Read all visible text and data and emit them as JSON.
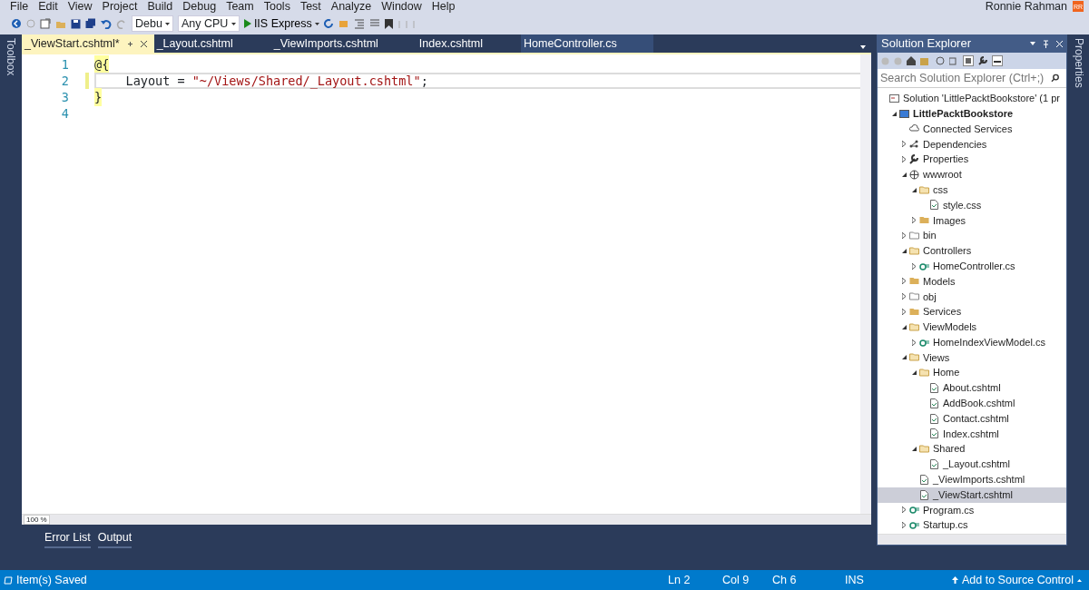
{
  "menu": [
    "File",
    "Edit",
    "View",
    "Project",
    "Build",
    "Debug",
    "Team",
    "Tools",
    "Test",
    "Analyze",
    "Window",
    "Help"
  ],
  "user": {
    "name": "Ronnie Rahman",
    "initials": "RR"
  },
  "toolbar": {
    "configuration": "Debu",
    "platform": "Any CPU",
    "run": "IIS Express"
  },
  "left_strip": "Toolbox",
  "right_strip": "Properties",
  "tabs": [
    {
      "label": "_ViewStart.cshtml*",
      "selected": true
    },
    {
      "label": "_Layout.cshtml",
      "selected": false
    },
    {
      "label": "_ViewImports.cshtml",
      "selected": false
    },
    {
      "label": "Index.cshtml",
      "selected": false
    },
    {
      "label": "HomeController.cs",
      "selected": false
    }
  ],
  "editor": {
    "zoom": "100 %",
    "lines": [
      {
        "number": "1",
        "current": false,
        "segments": [
          {
            "text": "@{",
            "kind": "razor"
          }
        ]
      },
      {
        "number": "2",
        "current": true,
        "segments": [
          {
            "text": "    Layout = ",
            "kind": "plain"
          },
          {
            "text": "\"~/Views/Shared/_Layout.cshtml\"",
            "kind": "string"
          },
          {
            "text": ";",
            "kind": "plain"
          }
        ]
      },
      {
        "number": "3",
        "current": false,
        "segments": [
          {
            "text": "}",
            "kind": "razor"
          }
        ]
      },
      {
        "number": "4",
        "current": false
      }
    ]
  },
  "solution_explorer": {
    "title": "Solution Explorer",
    "search": {
      "placeholder": "Search Solution Explorer (Ctrl+;)"
    },
    "tree": [
      {
        "label": "Solution 'LittlePacktBookstore' (1 pr",
        "kind": "solution",
        "selected": false,
        "children": [
          {
            "label": "LittlePacktBookstore",
            "kind": "project",
            "bold": true,
            "expanded": true,
            "selected": false,
            "children": [
              {
                "label": "Connected Services",
                "kind": "cloud",
                "selected": false
              },
              {
                "label": "Dependencies",
                "kind": "deps",
                "expanded": false,
                "selected": false
              },
              {
                "label": "Properties",
                "kind": "wrench",
                "expanded": false,
                "selected": false
              },
              {
                "label": "wwwroot",
                "kind": "globe",
                "expanded": true,
                "selected": false,
                "children": [
                  {
                    "label": "css",
                    "kind": "folder-open",
                    "expanded": true,
                    "selected": false,
                    "children": [
                      {
                        "label": "style.css",
                        "kind": "file",
                        "selected": false
                      }
                    ]
                  },
                  {
                    "label": "Images",
                    "kind": "folder",
                    "expanded": false,
                    "selected": false
                  }
                ]
              },
              {
                "label": "bin",
                "kind": "folder-empty",
                "expanded": false,
                "selected": false
              },
              {
                "label": "Controllers",
                "kind": "folder-open",
                "expanded": true,
                "selected": false,
                "children": [
                  {
                    "label": "HomeController.cs",
                    "kind": "csharp",
                    "expanded": false,
                    "selected": false
                  }
                ]
              },
              {
                "label": "Models",
                "kind": "folder",
                "expanded": false,
                "selected": false
              },
              {
                "label": "obj",
                "kind": "folder-empty",
                "expanded": false,
                "selected": false
              },
              {
                "label": "Services",
                "kind": "folder",
                "expanded": false,
                "selected": false
              },
              {
                "label": "ViewModels",
                "kind": "folder-open",
                "expanded": true,
                "selected": false,
                "children": [
                  {
                    "label": "HomeIndexViewModel.cs",
                    "kind": "csharp",
                    "expanded": false,
                    "selected": false
                  }
                ]
              },
              {
                "label": "Views",
                "kind": "folder-open",
                "expanded": true,
                "selected": false,
                "children": [
                  {
                    "label": "Home",
                    "kind": "folder-open",
                    "expanded": true,
                    "selected": false,
                    "children": [
                      {
                        "label": "About.cshtml",
                        "kind": "file",
                        "selected": false
                      },
                      {
                        "label": "AddBook.cshtml",
                        "kind": "file",
                        "selected": false
                      },
                      {
                        "label": "Contact.cshtml",
                        "kind": "file",
                        "selected": false
                      },
                      {
                        "label": "Index.cshtml",
                        "kind": "file",
                        "selected": false
                      }
                    ]
                  },
                  {
                    "label": "Shared",
                    "kind": "folder-open",
                    "expanded": true,
                    "selected": false,
                    "children": [
                      {
                        "label": "_Layout.cshtml",
                        "kind": "file",
                        "selected": false
                      }
                    ]
                  },
                  {
                    "label": "_ViewImports.cshtml",
                    "kind": "file",
                    "selected": false
                  },
                  {
                    "label": "_ViewStart.cshtml",
                    "kind": "file",
                    "selected": true
                  }
                ]
              },
              {
                "label": "Program.cs",
                "kind": "csharp",
                "expanded": false,
                "selected": false
              },
              {
                "label": "Startup.cs",
                "kind": "csharp",
                "expanded": false,
                "selected": false
              }
            ]
          }
        ]
      }
    ]
  },
  "bottom_tabs": [
    "Error List",
    "Output"
  ],
  "status_bar": {
    "message": "Item(s) Saved",
    "line": "Ln 2",
    "column": "Col 9",
    "char": "Ch 6",
    "mode": "INS",
    "source_control": "Add to Source Control"
  }
}
